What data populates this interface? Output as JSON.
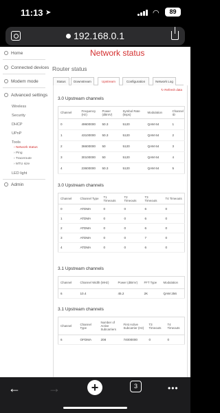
{
  "status_bar": {
    "time": "11:13",
    "battery": "89"
  },
  "browser": {
    "url": "192.168.0.1",
    "tab_count": "3"
  },
  "page": {
    "title": "Network status",
    "subtitle": "Router status",
    "refresh_label": "Refresh data",
    "tabs": [
      "Status",
      "Downstream",
      "Upstream",
      "Configuration",
      "Network Log"
    ],
    "active_tab": "Upstream"
  },
  "sidebar": {
    "home": "Home",
    "connected_devices": "Connected devices",
    "modem_mode": "Modem mode",
    "advanced_settings": "Advanced settings",
    "wireless": "Wireless",
    "security": "Security",
    "dhcp": "DHCP",
    "upnp": "UPnP",
    "tools": "Tools",
    "network_status": "Network status",
    "ping": "Ping",
    "traceroute": "Traceroute",
    "mtu_size": "MTU size",
    "led_light": "LED light",
    "admin": "Admin"
  },
  "tables": [
    {
      "title": "3.0 Upstream channels",
      "headers": [
        "Channel",
        "Frequency (Hz)",
        "Power (dBmV)",
        "Symbol Rate (ksps)",
        "Modulation",
        "Channel ID"
      ],
      "rows": [
        [
          "0",
          "49600000",
          "50.3",
          "5120",
          "QAM 64",
          "1"
        ],
        [
          "1",
          "43100000",
          "50.3",
          "5120",
          "QAM 64",
          "2"
        ],
        [
          "2",
          "36600000",
          "50",
          "5120",
          "QAM 64",
          "3"
        ],
        [
          "3",
          "30100000",
          "50",
          "5120",
          "QAM 64",
          "4"
        ],
        [
          "4",
          "23600000",
          "50.3",
          "5120",
          "QAM 64",
          "5"
        ]
      ]
    },
    {
      "title": "3.0 Upstream channels",
      "headers": [
        "Channel",
        "Channel Type",
        "T1 Timeouts",
        "T2 Timeouts",
        "T3 Timeouts",
        "T4 Timeouts"
      ],
      "rows": [
        [
          "0",
          "ATDMA",
          "0",
          "0",
          "6",
          "0"
        ],
        [
          "1",
          "ATDMA",
          "0",
          "0",
          "6",
          "0"
        ],
        [
          "2",
          "ATDMA",
          "0",
          "0",
          "6",
          "0"
        ],
        [
          "3",
          "ATDMA",
          "0",
          "0",
          "7",
          "0"
        ],
        [
          "4",
          "ATDMA",
          "0",
          "0",
          "6",
          "0"
        ]
      ]
    },
    {
      "title": "3.1 Upstream channels",
      "headers": [
        "Channel",
        "Channel Width (MHz)",
        "Power (dBmV)",
        "FFT Type",
        "Modulation"
      ],
      "rows": [
        [
          "6",
          "10.4",
          "45.2",
          "2K",
          "QAM 256"
        ]
      ]
    },
    {
      "title": "3.1 Upstream channels",
      "headers": [
        "Channel",
        "Channel Type",
        "Number of Active Subcarriers",
        "First Active Subcarrier (Hz)",
        "T3 Timeouts",
        "T4 Timeouts"
      ],
      "rows": [
        [
          "6",
          "OFDMA",
          "208",
          "74000000",
          "0",
          "0"
        ]
      ]
    }
  ]
}
